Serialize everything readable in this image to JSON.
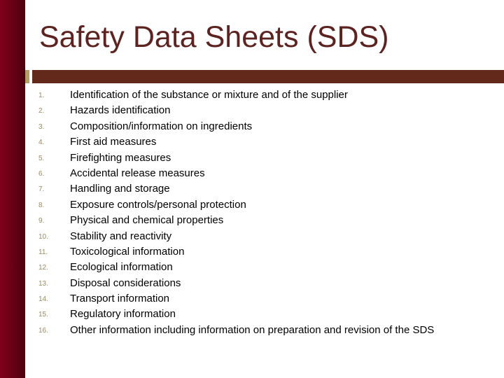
{
  "slide": {
    "title": "Safety Data Sheets (SDS)",
    "colors": {
      "sidebar": "#6a0016",
      "title_text": "#5c2320",
      "title_bar": "#632a1c",
      "accent_square": "#b49f6a",
      "number_text": "#9c8a5e"
    },
    "items": [
      {
        "number": "1.",
        "text": "Identification of the substance or mixture and of the supplier"
      },
      {
        "number": "2.",
        "text": "Hazards identification"
      },
      {
        "number": "3.",
        "text": "Composition/information on ingredients"
      },
      {
        "number": "4.",
        "text": "First aid measures"
      },
      {
        "number": "5.",
        "text": "Firefighting measures"
      },
      {
        "number": "6.",
        "text": "Accidental release measures"
      },
      {
        "number": "7.",
        "text": "Handling and storage"
      },
      {
        "number": "8.",
        "text": "Exposure controls/personal protection"
      },
      {
        "number": "9.",
        "text": "Physical and chemical properties"
      },
      {
        "number": "10.",
        "text": "Stability and reactivity"
      },
      {
        "number": "11.",
        "text": "Toxicological information"
      },
      {
        "number": "12.",
        "text": "Ecological information"
      },
      {
        "number": "13.",
        "text": "Disposal considerations"
      },
      {
        "number": "14.",
        "text": "Transport information"
      },
      {
        "number": "15.",
        "text": "Regulatory information"
      },
      {
        "number": "16.",
        "text": "Other information including information on preparation and revision of the SDS"
      }
    ]
  }
}
